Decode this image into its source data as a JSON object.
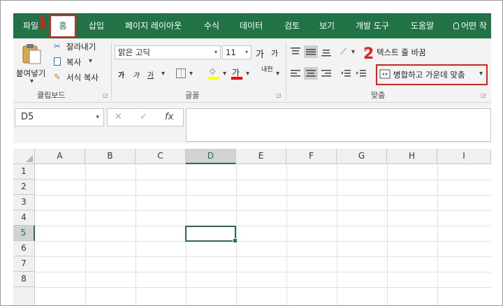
{
  "ribbon_tabs": [
    "파일",
    "홈",
    "삽입",
    "페이지 레이아웃",
    "수식",
    "데이터",
    "검토",
    "보기",
    "개발 도구",
    "도움말",
    "어떤 작"
  ],
  "steps": {
    "first": "1",
    "second": "2"
  },
  "clipboard": {
    "paste_label": "붙여넣기",
    "cut_label": "잘라내기",
    "copy_label": "복사",
    "format_painter_label": "서식 복사",
    "group_label": "클립보드"
  },
  "font": {
    "font_name": "맑은 고딕",
    "font_size": "11",
    "grow_glyph": "가",
    "shrink_glyph": "가",
    "bold_glyph": "가",
    "italic_glyph": "가",
    "underline_glyph": "가",
    "color_glyph": "가",
    "phonetic_glyph": "내천",
    "group_label": "글꼴"
  },
  "alignment": {
    "wrap_text_label": "텍스트 줄 바꿈",
    "merge_center_label": "병합하고 가운데 맞춤",
    "group_label": "맞춤"
  },
  "formula_bar": {
    "name_box": "D5",
    "cancel_glyph": "✕",
    "confirm_glyph": "✓",
    "fx_glyph": "fx"
  },
  "sheet": {
    "columns": [
      "A",
      "B",
      "C",
      "D",
      "E",
      "F",
      "G",
      "H",
      "I"
    ],
    "rows": [
      "1",
      "2",
      "3",
      "4",
      "5",
      "6",
      "7",
      "8"
    ],
    "selected_column": "D",
    "selected_row": "5"
  },
  "colors": {
    "brand": "#217346",
    "highlight": "#e0201b",
    "font_color": "#ff0000",
    "fill_color": "#ffff00"
  }
}
